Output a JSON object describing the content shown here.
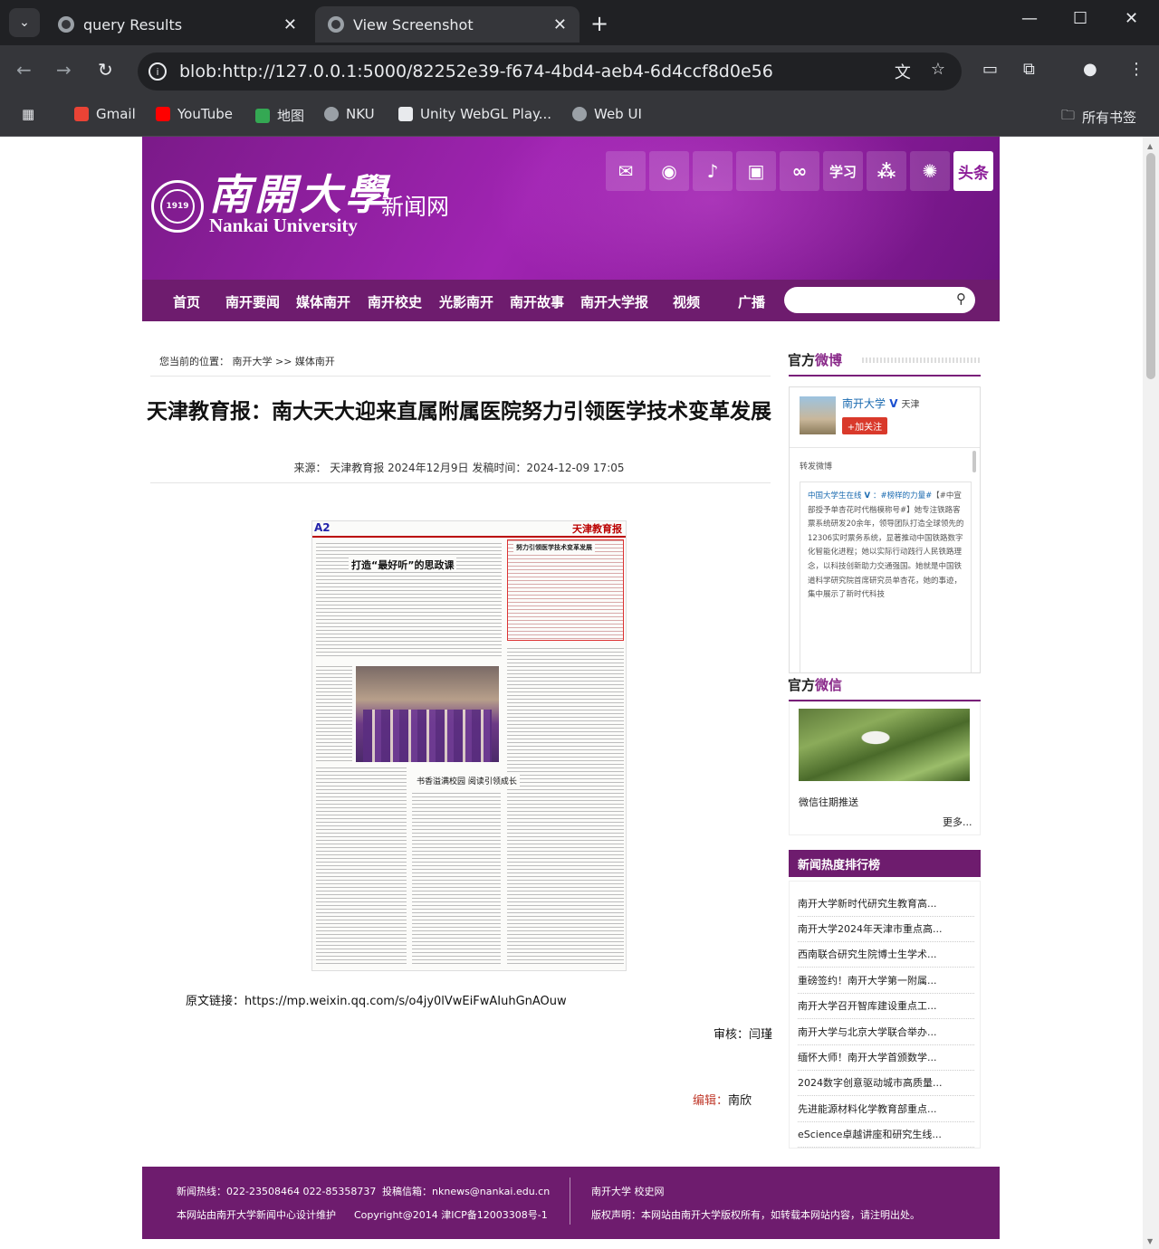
{
  "browser": {
    "tabs": [
      {
        "title": "query Results",
        "active": false
      },
      {
        "title": "View Screenshot",
        "active": true
      }
    ],
    "url": "blob:http://127.0.0.1:5000/82252e39-f674-4bd4-aeb4-6d4ccf8d0e56",
    "bookmarks": [
      "Gmail",
      "YouTube",
      "地图",
      "NKU",
      "Unity WebGL Play...",
      "Web UI"
    ],
    "all_bookmarks": "所有书签"
  },
  "site": {
    "logo_cn": "南開大學",
    "logo_en": "Nankai University",
    "logo_sub": "新闻网",
    "social_icons": [
      "wechat-icon",
      "weibo-icon",
      "douyin-icon",
      "bilibili-icon",
      "kuaishou-icon",
      "xuexi-icon",
      "channels-icon",
      "dandelion-icon",
      "toutiao-icon"
    ],
    "toutiao_label": "头条",
    "xuexi_label": "学习",
    "nav": [
      "首页",
      "南开要闻",
      "媒体南开",
      "南开校史",
      "光影南开",
      "南开故事",
      "南开大学报",
      "视频",
      "广播"
    ],
    "search_placeholder": ""
  },
  "article": {
    "breadcrumb": "您当前的位置： 南开大学 >> 媒体南开",
    "title": "天津教育报：南大天大迎来直属附属医院努力引领医学技术变革发展",
    "meta": "来源：  天津教育报 2024年12月9日  发稿时间：2024-12-09 17:05",
    "newspaper": {
      "page": "A2",
      "masthead": "天津教育报",
      "headline1": "打造“最好听”的思政课",
      "headline2": "努力引领医学技术变革发展",
      "headline3": "书香溢满校园 阅读引领成长"
    },
    "original_link": "原文链接：https://mp.weixin.qq.com/s/o4jy0lVwEiFwAIuhGnAOuw",
    "review": "审核：闫瑾",
    "editor_label": "编辑：",
    "editor_name": "南欣"
  },
  "sidebar": {
    "weibo_title_a": "官方",
    "weibo_title_b": "微博",
    "weibo_account": "南开大学",
    "weibo_city": "天津",
    "follow_label": "+加关注",
    "repost_label": "转发微博",
    "weibo_post_user": "中国大学生在线",
    "weibo_post_tag": "：#榜样的力量#",
    "weibo_post_text": "【#中宣部授予单杏花时代楷模称号#】她专注铁路客票系统研发20余年，领导团队打造全球领先的12306实时票务系统，显著推动中国铁路数字化智能化进程；她以实际行动践行人民铁路理念，以科技创新助力交通强国。她就是中国铁道科学研究院首席研究员单杏花，她的事迹，集中展示了新时代科技",
    "wechat_title_a": "官方",
    "wechat_title_b": "微信",
    "wechat_caption": "微信往期推送",
    "wechat_more": "更多...",
    "ranking_title": "新闻热度排行榜",
    "ranking": [
      "南开大学新时代研究生教育高...",
      "南开大学2024年天津市重点高...",
      "西南联合研究生院博士生学术...",
      "重磅签约！南开大学第一附属...",
      "南开大学召开智库建设重点工...",
      "南开大学与北京大学联合举办...",
      "缅怀大师！南开大学首颁数学...",
      "2024数字创意驱动城市高质量...",
      "先进能源材料化学教育部重点...",
      "eScience卓越讲座和研究生线..."
    ]
  },
  "footer": {
    "hotline": "新闻热线：022-23508464 022-85358737",
    "email": "投稿信箱：nknews@nankai.edu.cn",
    "links": "南开大学  校史网",
    "maintainer": "本网站由南开大学新闻中心设计维护",
    "copyright": "Copyright@2014 津ICP备12003308号-1",
    "rights": "版权声明：本网站由南开大学版权所有，如转载本网站内容，请注明出处。"
  },
  "colors": {
    "brand_purple": "#6e1c6e",
    "banner_purple": "#a024b2",
    "accent_red": "#c0392b"
  }
}
